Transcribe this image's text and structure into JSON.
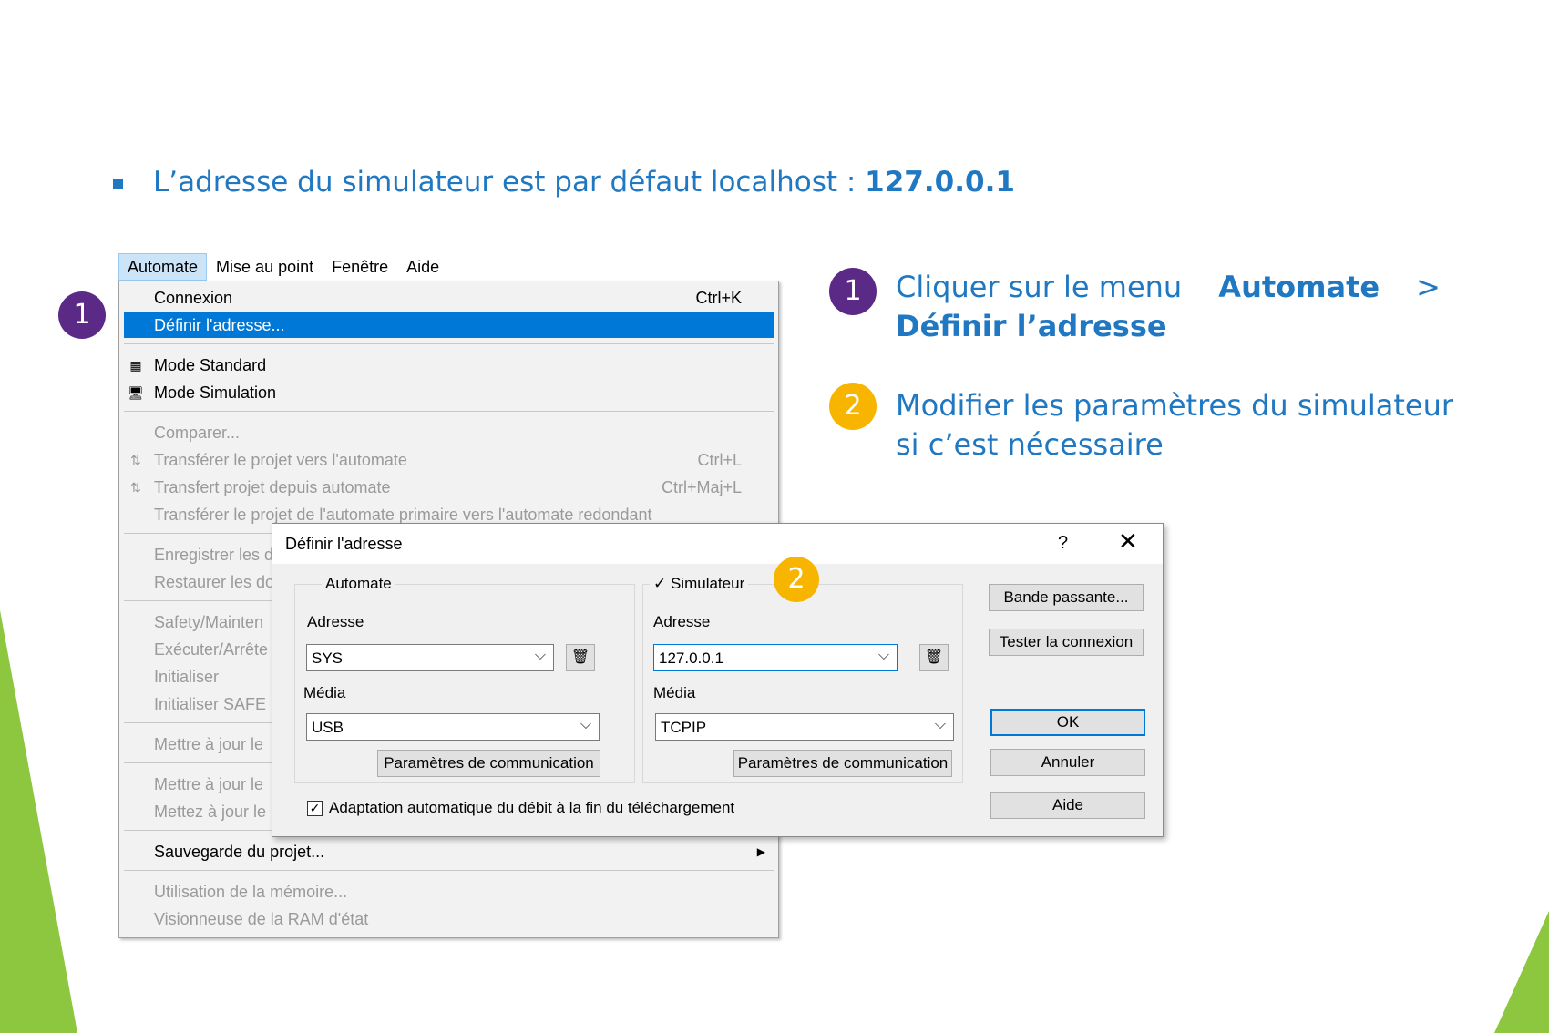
{
  "slide": {
    "bullet_text": "L’adresse du simulateur est par défaut localhost : ",
    "bullet_bold": "127.0.0.1",
    "step1_num": "1",
    "step1_text": "Cliquer sur le menu ",
    "step1_bold1": "Automate",
    "step1_sep": " > ",
    "step1_bold2": "Définir l’adresse",
    "step2_num": "2",
    "step2_text_line1": "Modifier les paramètres du simulateur",
    "step2_text_line2": "si c’est nécessaire",
    "left_badge": "1",
    "dialog_badge": "2"
  },
  "menubar": [
    "Automate",
    "Mise au point",
    "Fenêtre",
    "Aide"
  ],
  "menu": {
    "connexion": {
      "label": "Connexion",
      "shortcut": "Ctrl+K"
    },
    "definir": {
      "label": "Définir l'adresse..."
    },
    "mode_standard": {
      "label": "Mode Standard"
    },
    "mode_simulation": {
      "label": "Mode Simulation"
    },
    "comparer": {
      "label": "Comparer..."
    },
    "transferer_vers": {
      "label": "Transférer le projet vers l'automate",
      "shortcut": "Ctrl+L"
    },
    "transfert_depuis": {
      "label": "Transfert projet depuis automate",
      "shortcut": "Ctrl+Maj+L"
    },
    "transferer_redondant": {
      "label": "Transférer le projet de l'automate primaire vers l'automate redondant"
    },
    "enregistrer": {
      "label": "Enregistrer les d"
    },
    "restaurer": {
      "label": "Restaurer les do"
    },
    "safety": {
      "label": "Safety/Mainten"
    },
    "executer": {
      "label": "Exécuter/Arrête"
    },
    "initialiser": {
      "label": "Initialiser"
    },
    "initialiser_safe": {
      "label": "Initialiser SAFE"
    },
    "mettre_jour1": {
      "label": "Mettre à jour le"
    },
    "mettre_jour2": {
      "label": "Mettre à jour le"
    },
    "mettez_jour": {
      "label": "Mettez à jour le"
    },
    "sauvegarde": {
      "label": "Sauvegarde du projet..."
    },
    "utilisation": {
      "label": "Utilisation de la mémoire..."
    },
    "visionneuse": {
      "label": "Visionneuse de la RAM d'état"
    }
  },
  "dialog": {
    "title": "Définir l'adresse",
    "help": "?",
    "close": "✕",
    "automate": {
      "group_label": "Automate",
      "adresse_label": "Adresse",
      "adresse_value": "SYS",
      "media_label": "Média",
      "media_value": "USB",
      "comm_button": "Paramètres de communication"
    },
    "simulateur": {
      "group_label": "✓ Simulateur",
      "adresse_label": "Adresse",
      "adresse_value": "127.0.0.1",
      "media_label": "Média",
      "media_value": "TCPIP",
      "comm_button": "Paramètres de communication"
    },
    "checkbox_label": "Adaptation automatique du débit à la fin du téléchargement",
    "buttons": {
      "bande": "Bande passante...",
      "tester": "Tester la connexion",
      "ok": "OK",
      "annuler": "Annuler",
      "aide": "Aide"
    }
  },
  "colors": {
    "accent_blue": "#1f78c1",
    "badge_purple": "#5b2a86",
    "badge_yellow": "#f7b500",
    "highlight": "#0078d7",
    "slide_green": "#8dc63f"
  }
}
